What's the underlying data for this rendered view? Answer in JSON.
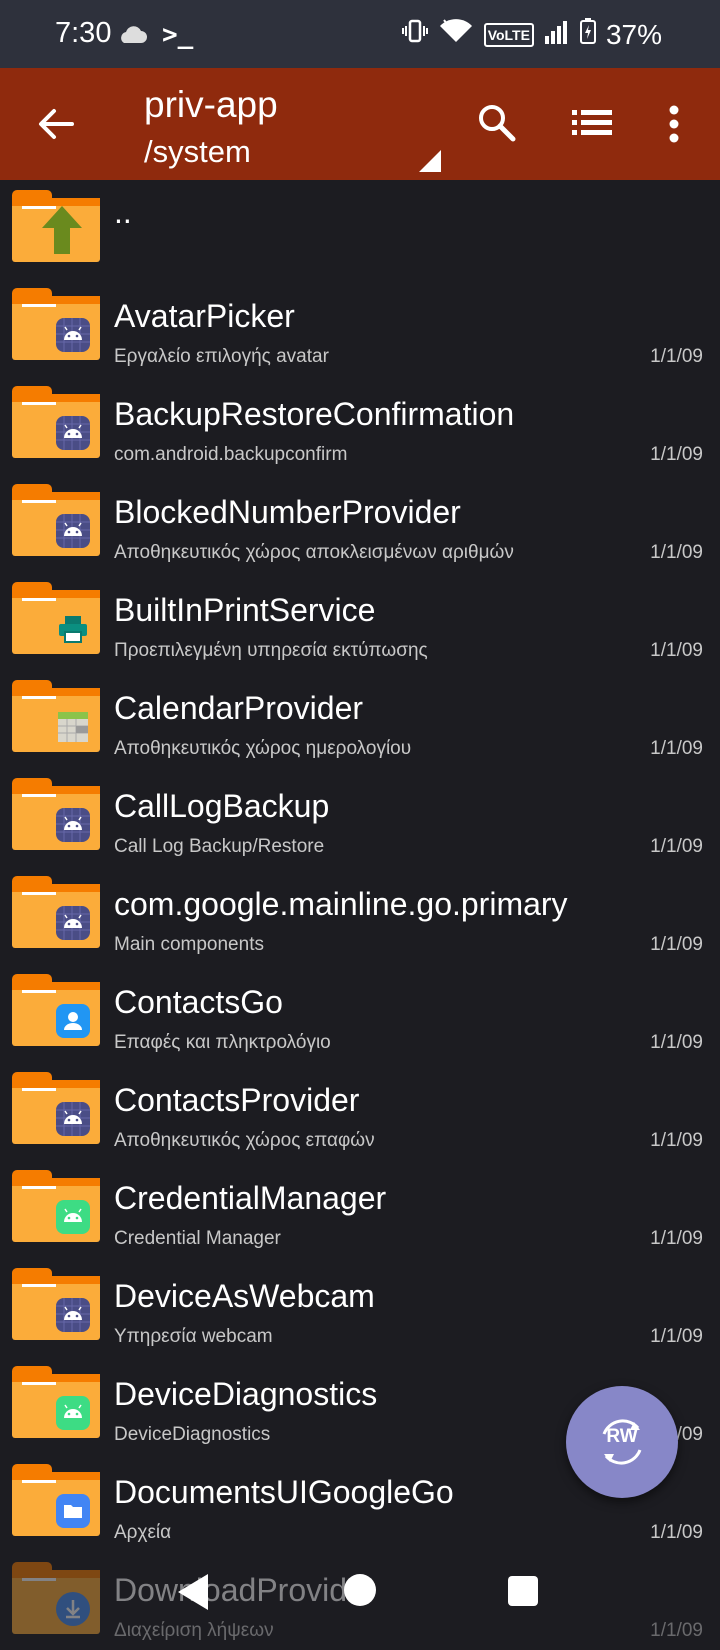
{
  "status_bar": {
    "time": "7:30",
    "terminal_glyph": ">_",
    "volte": "VoLTE",
    "battery": "37%"
  },
  "app_bar": {
    "title": "priv-app",
    "subtitle": "/system"
  },
  "parent_entry": {
    "name": ".."
  },
  "files": [
    {
      "name": "AvatarPicker",
      "desc": "Εργαλείο επιλογής avatar",
      "date": "1/1/09",
      "icon": "android-icon"
    },
    {
      "name": "BackupRestoreConfirmation",
      "desc": "com.android.backupconfirm",
      "date": "1/1/09",
      "icon": "android-icon"
    },
    {
      "name": "BlockedNumberProvider",
      "desc": "Αποθηκευτικός χώρος αποκλεισμένων αριθμών",
      "date": "1/1/09",
      "icon": "android-icon"
    },
    {
      "name": "BuiltInPrintService",
      "desc": "Προεπιλεγμένη υπηρεσία εκτύπωσης",
      "date": "1/1/09",
      "icon": "printer-icon"
    },
    {
      "name": "CalendarProvider",
      "desc": "Αποθηκευτικός χώρος ημερολογίου",
      "date": "1/1/09",
      "icon": "calendar-icon"
    },
    {
      "name": "CallLogBackup",
      "desc": "Call Log Backup/Restore",
      "date": "1/1/09",
      "icon": "android-icon"
    },
    {
      "name": "com.google.mainline.go.primary",
      "desc": "Main components",
      "date": "1/1/09",
      "icon": "android-icon"
    },
    {
      "name": "ContactsGo",
      "desc": "Επαφές και πληκτρολόγιο",
      "date": "1/1/09",
      "icon": "contacts-icon"
    },
    {
      "name": "ContactsProvider",
      "desc": "Αποθηκευτικός χώρος επαφών",
      "date": "1/1/09",
      "icon": "android-icon"
    },
    {
      "name": "CredentialManager",
      "desc": "Credential Manager",
      "date": "1/1/09",
      "icon": "android-green-icon"
    },
    {
      "name": "DeviceAsWebcam",
      "desc": "Υπηρεσία webcam",
      "date": "1/1/09",
      "icon": "android-icon"
    },
    {
      "name": "DeviceDiagnostics",
      "desc": "DeviceDiagnostics",
      "date": "1/1/09",
      "icon": "android-green-icon"
    },
    {
      "name": "DocumentsUIGoogleGo",
      "desc": "Αρχεία",
      "date": "1/1/09",
      "icon": "files-icon"
    },
    {
      "name": "DownloadProvider",
      "desc": "Διαχείριση λήψεων",
      "date": "1/1/09",
      "icon": "download-icon"
    }
  ],
  "fab": {
    "label": "RW"
  },
  "colors": {
    "appbar": "#8f2a0d",
    "statusbar": "#2e313c",
    "background": "#1c1c21",
    "folder": "#fbac3a",
    "fab": "#8787c8"
  }
}
